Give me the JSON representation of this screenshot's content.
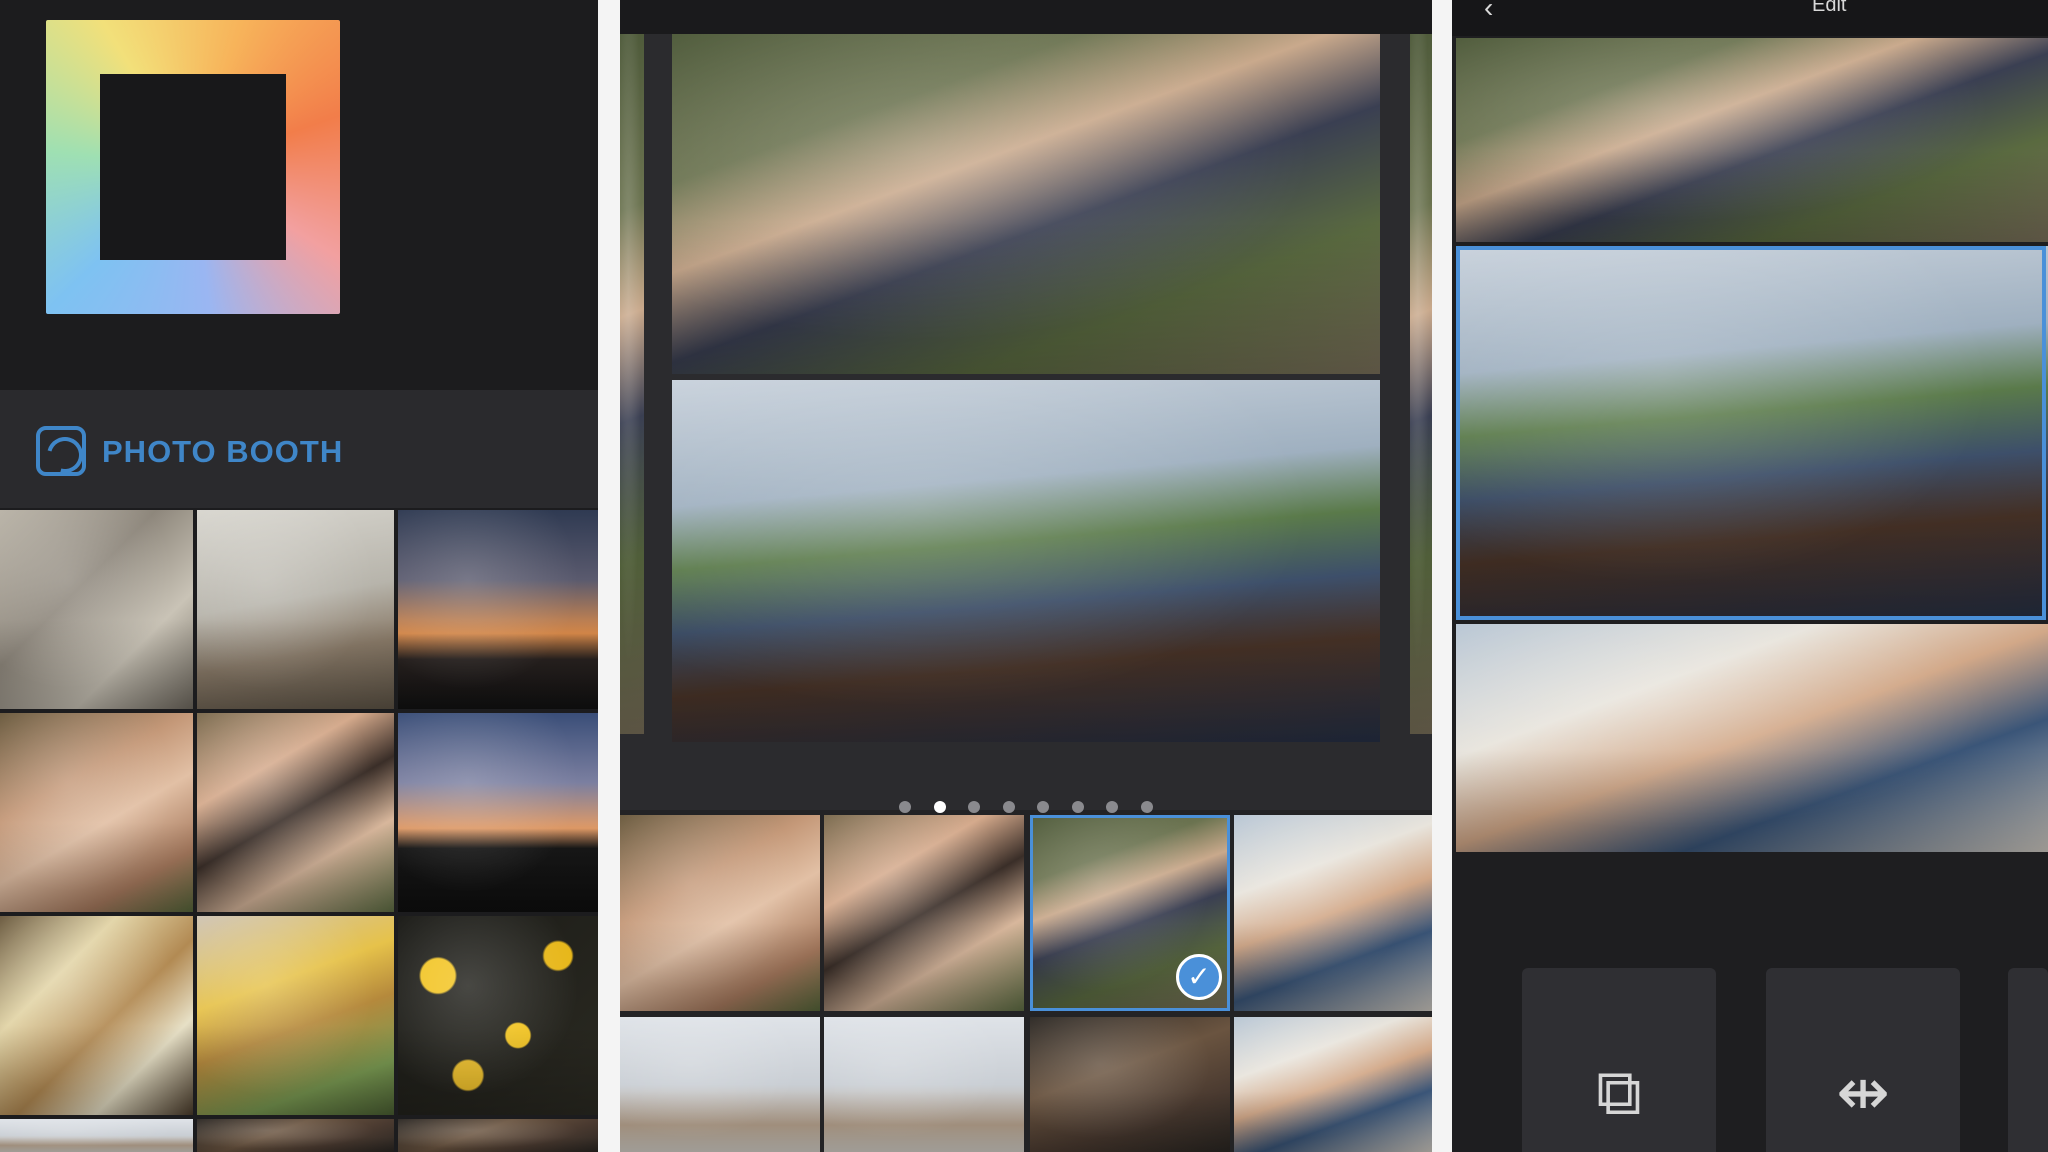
{
  "left": {
    "booth_label": "PHOTO BOOTH",
    "booth_icon": "photo-booth-icon",
    "logo_icon": "layout-logo"
  },
  "middle": {
    "page_dots": {
      "count": 8,
      "active_index": 1
    },
    "selected_icon": "checkmark-icon",
    "check_glyph": "✓"
  },
  "right": {
    "title": "Edit",
    "back_glyph": "‹",
    "tools": [
      {
        "name": "replace-tool",
        "icon": "replace-icon",
        "glyph": "⧉"
      },
      {
        "name": "mirror-tool",
        "icon": "mirror-icon",
        "glyph": "⇹"
      }
    ]
  },
  "colors": {
    "accent": "#4a90d9",
    "booth_blue": "#3f86c8",
    "panel_dark": "#1c1c1e"
  }
}
